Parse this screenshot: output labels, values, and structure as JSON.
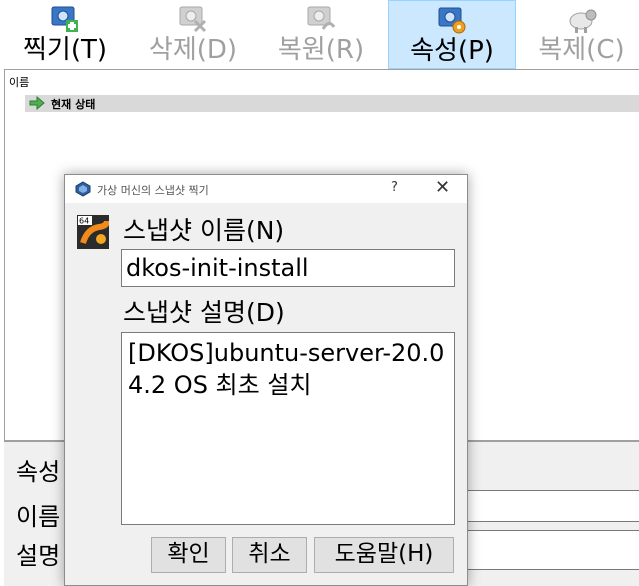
{
  "toolbar": {
    "take": "찍기(T)",
    "delete": "삭제(D)",
    "restore": "복원(R)",
    "properties": "속성(P)",
    "clone": "복제(C)"
  },
  "tree": {
    "header": "이름",
    "current_state": "현재 상태"
  },
  "properties_panel": {
    "title": "속성",
    "name_label": "이름",
    "desc_label": "설명"
  },
  "dialog": {
    "title": "가상 머신의 스냅샷 찍기",
    "help_glyph": "?",
    "close_glyph": "✕",
    "name_label": "스냅샷 이름(N)",
    "name_value": "dkos-init-install",
    "desc_label": "스냅샷 설명(D)",
    "desc_value": "[DKOS]ubuntu-server-20.04.2 OS 최초 설치",
    "ok": "확인",
    "cancel": "취소",
    "help": "도움말(H)"
  },
  "colors": {
    "active_tab": "#cce8ff",
    "selected_row": "#d9d9d9"
  }
}
